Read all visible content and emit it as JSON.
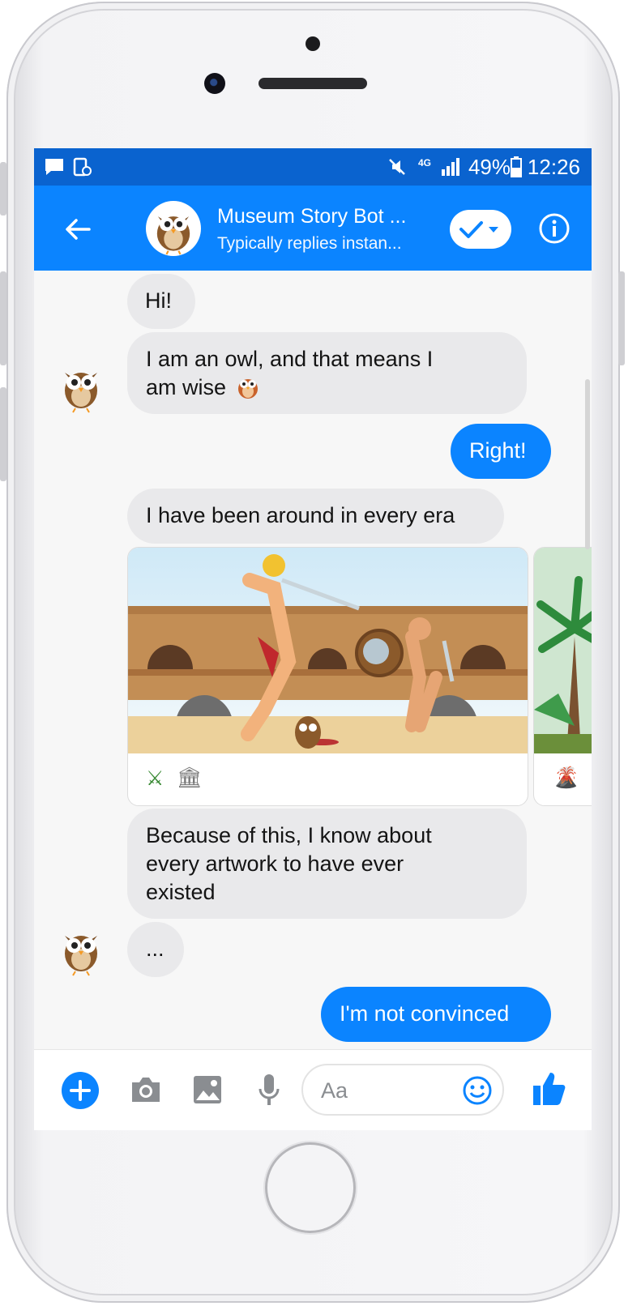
{
  "status_bar": {
    "battery": "49%",
    "time": "12:26",
    "network_label": "4G"
  },
  "header": {
    "name": "Museum Story Bot ...",
    "status": "Typically replies instan..."
  },
  "messages": [
    {
      "from": "bot",
      "text": "Hi!"
    },
    {
      "from": "bot",
      "text": "I am an owl, and that means I",
      "text2": "am wise"
    },
    {
      "from": "user",
      "text": "Right!"
    },
    {
      "from": "bot",
      "text": "I have been around in every era"
    },
    {
      "from": "bot",
      "text": "Because of this, I know about",
      "text2": "every artwork to have ever",
      "text3": "existed"
    },
    {
      "from": "bot",
      "text": "..."
    },
    {
      "from": "user",
      "text": "I'm not convinced"
    }
  ],
  "cards": [
    {
      "emojis": [
        "⚔",
        "🏛"
      ]
    },
    {
      "emojis": [
        "🌋"
      ]
    }
  ],
  "composer": {
    "placeholder": "Aa"
  },
  "colors": {
    "messenger_blue": "#0b84ff",
    "status_blue": "#0a63cf",
    "bubble_gray": "#e9e9eb"
  },
  "icons": [
    "back-arrow-icon",
    "check-dropdown-icon",
    "info-icon",
    "plus-icon",
    "camera-icon",
    "image-icon",
    "mic-icon",
    "emoji-icon",
    "thumbs-up-icon"
  ]
}
